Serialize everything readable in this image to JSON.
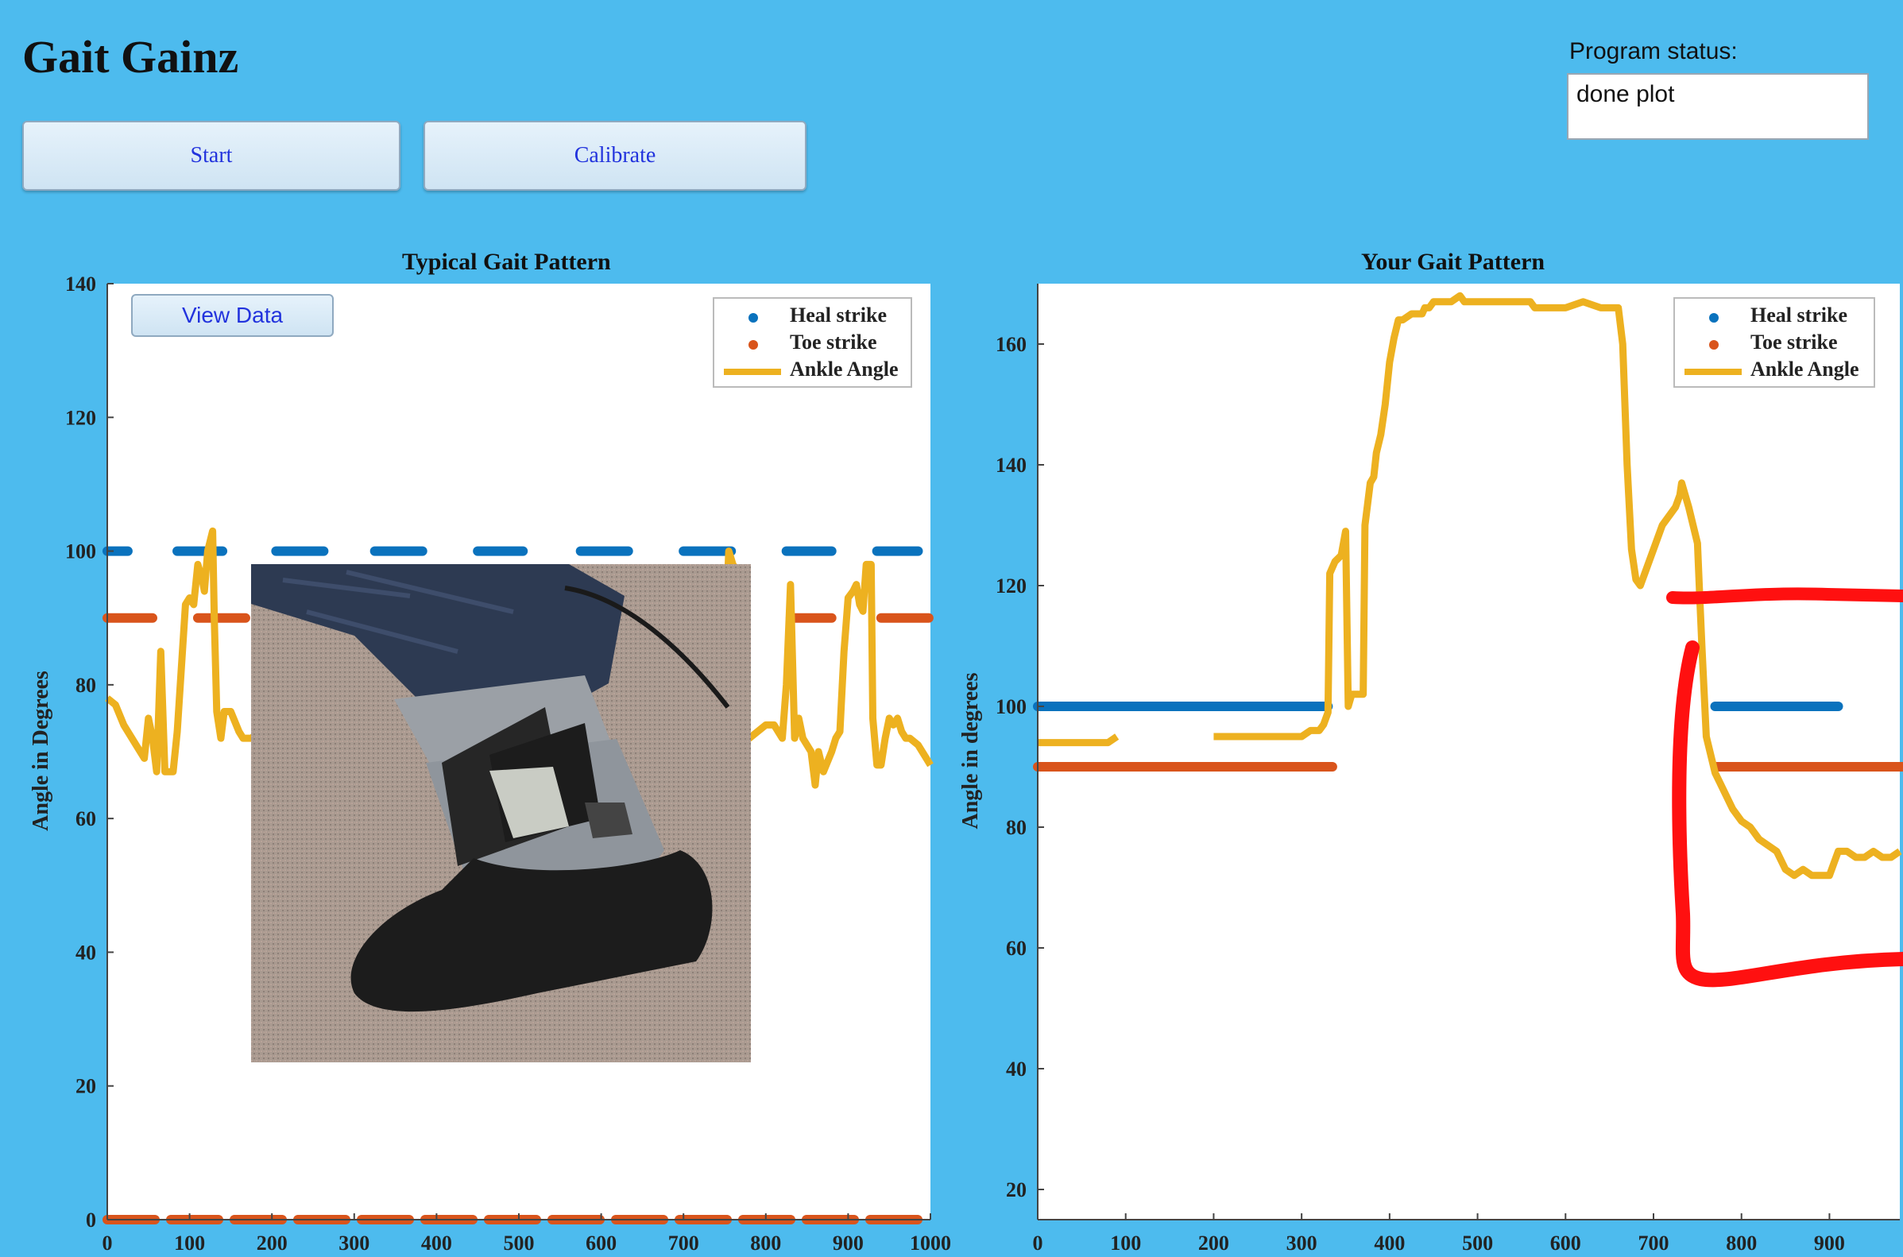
{
  "app": {
    "title": "Gait Gainz"
  },
  "toolbar": {
    "start_label": "Start",
    "calibrate_label": "Calibrate"
  },
  "status": {
    "label": "Program status:",
    "value": "done plot"
  },
  "view_data_label": "View Data",
  "legend": {
    "heal": "Heal strike",
    "toe": "Toe strike",
    "ankle": "Ankle Angle"
  },
  "colors": {
    "heal": "#0a72bd",
    "toe": "#d9541b",
    "ankle": "#edb120",
    "annotation": "#ff1010",
    "background": "#4dbbee"
  },
  "chart_data": [
    {
      "type": "line",
      "title": "Typical Gait Pattern",
      "ylabel": "Angle in Degrees",
      "xlabel": "",
      "xlim": [
        0,
        1000
      ],
      "ylim": [
        0,
        140
      ],
      "xticks": [
        0,
        100,
        200,
        300,
        400,
        500,
        600,
        700,
        800,
        900,
        1000
      ],
      "yticks": [
        0,
        20,
        40,
        60,
        80,
        100,
        120,
        140
      ],
      "legend_position": "top-right",
      "series": [
        {
          "name": "Heal strike",
          "style": "dashed",
          "segments": [
            [
              [
                0,
                100
              ],
              [
                25,
                100
              ]
            ],
            [
              [
                85,
                100
              ],
              [
                140,
                100
              ]
            ],
            [
              [
                205,
                100
              ],
              [
                265,
                100
              ]
            ],
            [
              [
                325,
                100
              ],
              [
                385,
                100
              ]
            ],
            [
              [
                450,
                100
              ],
              [
                505,
                100
              ]
            ],
            [
              [
                575,
                100
              ],
              [
                640,
                100
              ]
            ],
            [
              [
                700,
                100
              ],
              [
                765,
                100
              ]
            ],
            [
              [
                825,
                100
              ],
              [
                880,
                100
              ]
            ],
            [
              [
                935,
                100
              ],
              [
                985,
                100
              ]
            ]
          ]
        },
        {
          "name": "Toe strike",
          "style": "dashed",
          "segments": [
            [
              [
                0,
                90
              ],
              [
                55,
                90
              ]
            ],
            [
              [
                110,
                90
              ],
              [
                175,
                90
              ]
            ],
            [
              [
                830,
                90
              ],
              [
                880,
                90
              ]
            ],
            [
              [
                940,
                90
              ],
              [
                1000,
                90
              ]
            ],
            [
              [
                0,
                0
              ],
              [
                1000,
                0
              ]
            ]
          ]
        },
        {
          "name": "Ankle Angle",
          "style": "line",
          "points": [
            [
              0,
              78
            ],
            [
              10,
              77
            ],
            [
              20,
              74
            ],
            [
              35,
              71
            ],
            [
              45,
              69
            ],
            [
              50,
              75
            ],
            [
              55,
              72
            ],
            [
              60,
              67
            ],
            [
              65,
              85
            ],
            [
              70,
              67
            ],
            [
              80,
              67
            ],
            [
              85,
              73
            ],
            [
              95,
              92
            ],
            [
              100,
              93
            ],
            [
              105,
              92
            ],
            [
              110,
              98
            ],
            [
              115,
              96
            ],
            [
              118,
              94
            ],
            [
              122,
              100
            ],
            [
              128,
              103
            ],
            [
              130,
              90
            ],
            [
              133,
              76
            ],
            [
              138,
              72
            ],
            [
              142,
              76
            ],
            [
              150,
              76
            ],
            [
              160,
              73
            ],
            [
              165,
              72
            ],
            [
              175,
              72
            ],
            [
              185,
              73
            ],
            [
              190,
              74
            ],
            [
              195,
              72
            ],
            [
              200,
              72
            ],
            [
              205,
              75
            ],
            [
              210,
              78
            ],
            [
              560,
              67
            ],
            [
              570,
              72
            ],
            [
              580,
              68
            ],
            [
              600,
              69
            ],
            [
              610,
              68
            ],
            [
              625,
              70
            ],
            [
              630,
              72
            ],
            [
              640,
              68
            ],
            [
              650,
              67
            ],
            [
              660,
              66
            ],
            [
              670,
              65
            ],
            [
              680,
              66
            ],
            [
              700,
              70
            ],
            [
              710,
              70
            ],
            [
              730,
              71
            ],
            [
              735,
              75
            ],
            [
              740,
              73
            ],
            [
              748,
              75
            ],
            [
              750,
              85
            ],
            [
              755,
              100
            ],
            [
              760,
              98
            ],
            [
              765,
              97
            ],
            [
              768,
              80
            ],
            [
              772,
              72
            ],
            [
              780,
              72
            ],
            [
              800,
              74
            ],
            [
              810,
              74
            ],
            [
              820,
              72
            ],
            [
              825,
              80
            ],
            [
              830,
              95
            ],
            [
              835,
              72
            ],
            [
              840,
              75
            ],
            [
              845,
              72
            ],
            [
              855,
              70
            ],
            [
              860,
              65
            ],
            [
              864,
              70
            ],
            [
              870,
              67
            ],
            [
              880,
              70
            ],
            [
              885,
              72
            ],
            [
              890,
              73
            ],
            [
              895,
              85
            ],
            [
              900,
              93
            ],
            [
              906,
              94
            ],
            [
              910,
              95
            ],
            [
              914,
              92
            ],
            [
              918,
              91
            ],
            [
              922,
              98
            ],
            [
              928,
              98
            ],
            [
              930,
              75
            ],
            [
              935,
              68
            ],
            [
              940,
              68
            ],
            [
              945,
              72
            ],
            [
              950,
              75
            ],
            [
              955,
              74
            ],
            [
              960,
              75
            ],
            [
              965,
              73
            ],
            [
              970,
              72
            ],
            [
              975,
              72
            ],
            [
              985,
              71
            ],
            [
              990,
              70
            ],
            [
              995,
              69
            ],
            [
              1000,
              68
            ]
          ]
        }
      ]
    },
    {
      "type": "line",
      "title": "Your Gait Pattern",
      "ylabel": "Angle in degrees",
      "xlabel": "",
      "xlim": [
        0,
        980
      ],
      "ylim": [
        15,
        170
      ],
      "xticks": [
        0,
        100,
        200,
        300,
        400,
        500,
        600,
        700,
        800,
        900
      ],
      "yticks": [
        20,
        40,
        60,
        80,
        100,
        120,
        140,
        160
      ],
      "legend_position": "top-right",
      "series": [
        {
          "name": "Heal strike",
          "style": "line",
          "segments": [
            [
              [
                0,
                100
              ],
              [
                330,
                100
              ]
            ],
            [
              [
                770,
                100
              ],
              [
                910,
                100
              ]
            ]
          ]
        },
        {
          "name": "Toe strike",
          "style": "line",
          "segments": [
            [
              [
                0,
                90
              ],
              [
                335,
                90
              ]
            ],
            [
              [
                770,
                90
              ],
              [
                985,
                90
              ]
            ]
          ]
        },
        {
          "name": "Ankle Angle",
          "style": "line",
          "points": [
            [
              0,
              94
            ],
            [
              80,
              94
            ],
            [
              90,
              95
            ],
            [
              200,
              95
            ],
            [
              300,
              95
            ],
            [
              310,
              96
            ],
            [
              320,
              96
            ],
            [
              325,
              97
            ],
            [
              330,
              99
            ],
            [
              332,
              122
            ],
            [
              338,
              124
            ],
            [
              345,
              125
            ],
            [
              350,
              129
            ],
            [
              353,
              100
            ],
            [
              357,
              102
            ],
            [
              360,
              102
            ],
            [
              365,
              102
            ],
            [
              370,
              102
            ],
            [
              372,
              130
            ],
            [
              378,
              137
            ],
            [
              382,
              138
            ],
            [
              385,
              142
            ],
            [
              390,
              145
            ],
            [
              395,
              150
            ],
            [
              400,
              157
            ],
            [
              405,
              161
            ],
            [
              410,
              164
            ],
            [
              415,
              164
            ],
            [
              425,
              165
            ],
            [
              432,
              165
            ],
            [
              437,
              165
            ],
            [
              440,
              166
            ],
            [
              445,
              166
            ],
            [
              450,
              167
            ],
            [
              460,
              167
            ],
            [
              465,
              167
            ],
            [
              470,
              167
            ],
            [
              480,
              168
            ],
            [
              485,
              167
            ],
            [
              500,
              167
            ],
            [
              520,
              167
            ],
            [
              540,
              167
            ],
            [
              560,
              167
            ],
            [
              565,
              166
            ],
            [
              580,
              166
            ],
            [
              600,
              166
            ],
            [
              620,
              167
            ],
            [
              640,
              166
            ],
            [
              650,
              166
            ],
            [
              655,
              166
            ],
            [
              660,
              166
            ],
            [
              665,
              160
            ],
            [
              670,
              140
            ],
            [
              675,
              126
            ],
            [
              680,
              121
            ],
            [
              685,
              120
            ],
            [
              690,
              122
            ],
            [
              700,
              126
            ],
            [
              710,
              130
            ],
            [
              720,
              132
            ],
            [
              725,
              133
            ],
            [
              730,
              135
            ],
            [
              732,
              137
            ],
            [
              736,
              135
            ],
            [
              740,
              133
            ],
            [
              745,
              130
            ],
            [
              750,
              127
            ],
            [
              752,
              120
            ],
            [
              755,
              110
            ],
            [
              760,
              95
            ],
            [
              770,
              89
            ],
            [
              780,
              86
            ],
            [
              790,
              83
            ],
            [
              800,
              81
            ],
            [
              810,
              80
            ],
            [
              820,
              78
            ],
            [
              830,
              77
            ],
            [
              840,
              76
            ],
            [
              850,
              73
            ],
            [
              860,
              72
            ],
            [
              870,
              73
            ],
            [
              880,
              72
            ],
            [
              890,
              72
            ],
            [
              895,
              72
            ],
            [
              900,
              72
            ],
            [
              905,
              74
            ],
            [
              910,
              76
            ],
            [
              920,
              76
            ],
            [
              930,
              75
            ],
            [
              940,
              75
            ],
            [
              950,
              76
            ],
            [
              960,
              75
            ],
            [
              970,
              75
            ],
            [
              980,
              76
            ]
          ]
        }
      ]
    }
  ]
}
